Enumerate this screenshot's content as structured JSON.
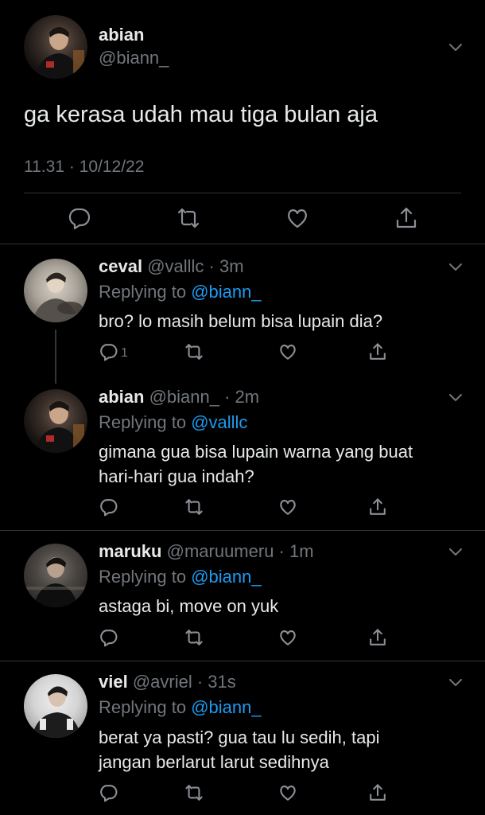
{
  "main_tweet": {
    "name": "abian",
    "handle": "@biann_",
    "text": "ga kerasa udah mau tiga bulan aja",
    "timestamp": "11.31 · 10/12/22"
  },
  "replies": [
    {
      "name": "ceval",
      "handle_time": "@valllc · 3m",
      "replying_label": "Replying to",
      "replying_to": "@biann_",
      "lines": [
        "bro? lo masih belum bisa lupain dia?"
      ],
      "reply_count": "1"
    },
    {
      "name": "abian",
      "handle_time": "@biann_ · 2m",
      "replying_label": "Replying to",
      "replying_to": "@valllc",
      "lines": [
        "gimana gua bisa lupain warna yang buat",
        "hari-hari gua indah?"
      ]
    },
    {
      "name": "maruku",
      "handle_time": "@maruumeru · 1m",
      "replying_label": "Replying to",
      "replying_to": "@biann_",
      "lines": [
        "astaga bi, move on yuk"
      ]
    },
    {
      "name": "viel",
      "handle_time": "@avriel · 31s",
      "replying_label": "Replying to",
      "replying_to": "@biann_",
      "lines": [
        "berat ya pasti? gua tau lu sedih, tapi",
        "jangan berlarut larut sedihnya"
      ]
    }
  ],
  "icons": {
    "reply": "reply-icon",
    "retweet": "retweet-icon",
    "like": "like-icon",
    "share": "share-icon",
    "more": "chevron-down-icon"
  },
  "colors": {
    "background": "#000000",
    "text": "#e7e9ea",
    "secondary": "#71767b",
    "link": "#1d9bf0",
    "divider": "#2f3336"
  }
}
